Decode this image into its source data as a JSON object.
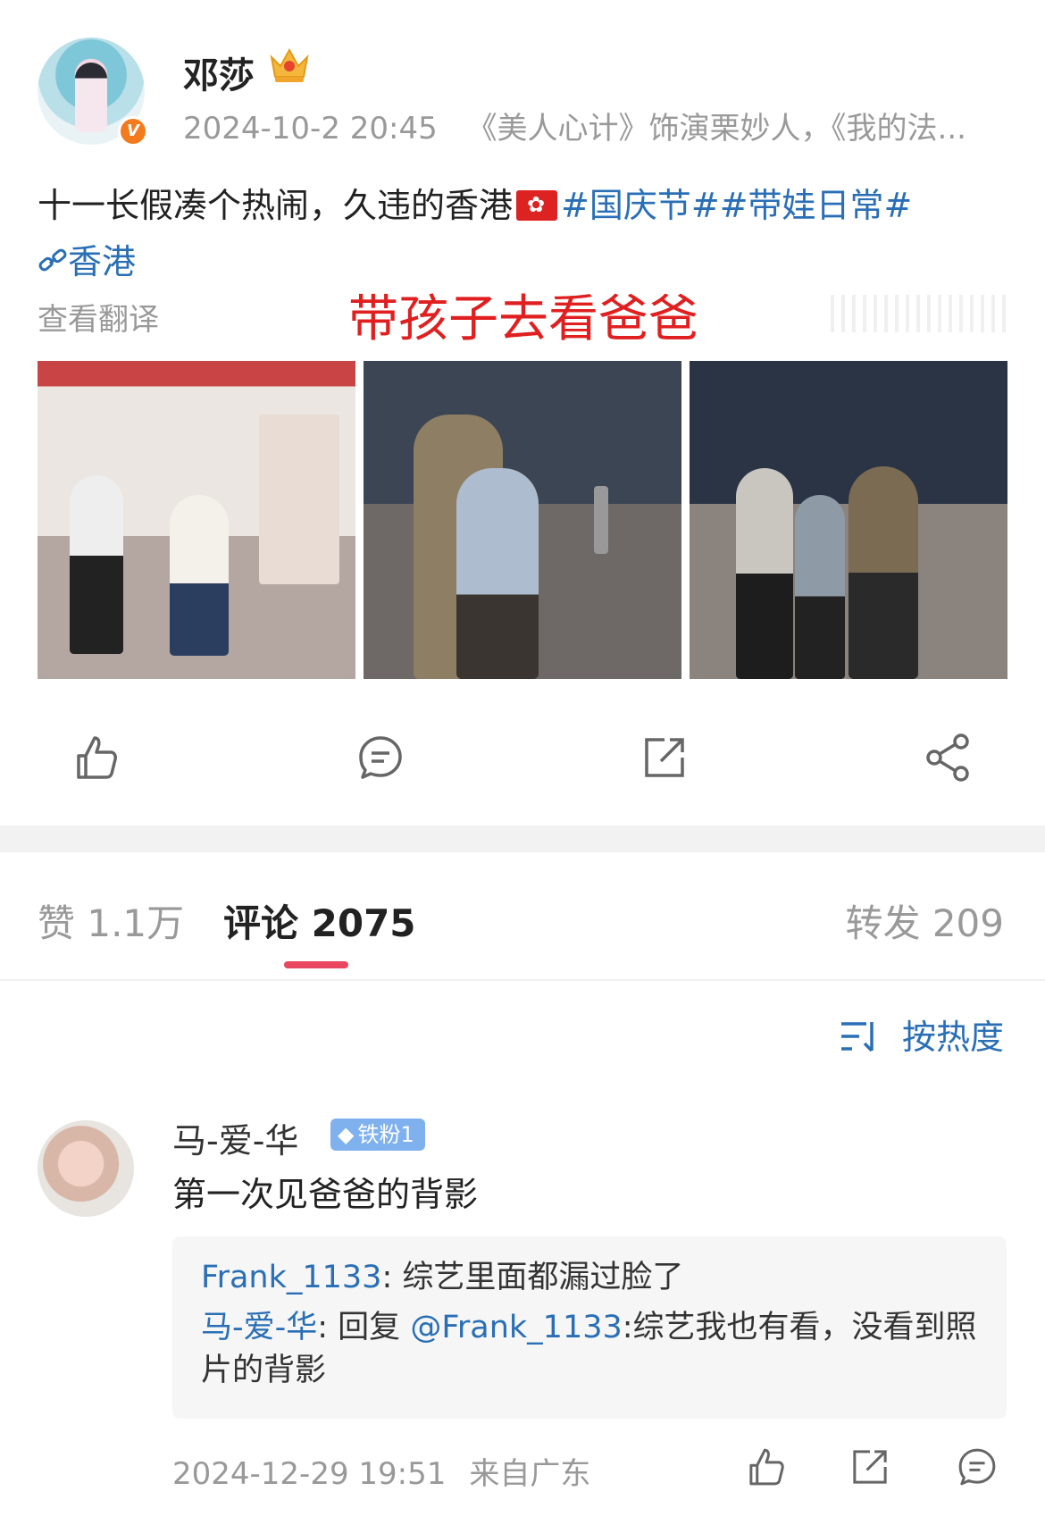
{
  "post": {
    "author": "邓莎",
    "verified_badge": "V",
    "date": "2024-10-2 20:45",
    "author_bio": "《美人心计》饰演栗妙人，《我的法...",
    "text": "十一长假凑个热闹，久违的香港",
    "flag_icon": "hong-kong-flag",
    "hashtags": "#国庆节##带娃日常#",
    "location": "香港",
    "translate_label": "查看翻译",
    "overlay_caption": "带孩子去看爸爸"
  },
  "actions": [
    "like-icon",
    "comment-icon",
    "repost-icon",
    "share-icon"
  ],
  "tabs": {
    "likes": "赞 1.1万",
    "comments": "评论 2075",
    "reposts": "转发 209"
  },
  "sort": {
    "label": "按热度"
  },
  "comment": {
    "name": "马-爱-华",
    "badge": "铁粉1",
    "text": "第一次见爸爸的背影",
    "replies": [
      {
        "user": "Frank_1133",
        "text": ": 综艺里面都漏过脸了"
      },
      {
        "user": "马-爱-华",
        "prefix": ": 回复 ",
        "mention": "@Frank_1133",
        "text": ":综艺我也有看，没看到照片的背影"
      }
    ],
    "time": "2024-12-29 19:51",
    "from": "来自广东"
  },
  "colors": {
    "link": "#2a6fb5",
    "accent": "#e8475f",
    "caption": "#e02020",
    "muted": "#999999"
  }
}
